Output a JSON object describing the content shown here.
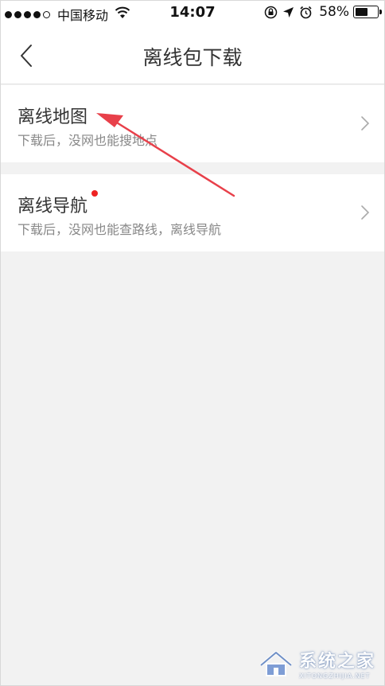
{
  "status_bar": {
    "carrier": "中国移动",
    "time": "14:07",
    "battery_percent": "58%",
    "battery_level": 0.58,
    "icons": [
      "signal-dots-icon",
      "wifi-icon",
      "orientation-lock-icon",
      "location-arrow-icon",
      "alarm-icon",
      "battery-icon"
    ]
  },
  "nav": {
    "title": "离线包下载",
    "back_icon": "chevron-left-icon"
  },
  "list": {
    "items": [
      {
        "title": "离线地图",
        "subtitle": "下载后，没网也能搜地点",
        "has_badge": false
      },
      {
        "title": "离线导航",
        "subtitle": "下载后，没网也能查路线，离线导航",
        "has_badge": true
      }
    ]
  },
  "annotation": {
    "color": "#e8404a"
  },
  "watermark": {
    "text_cn": "系统之家",
    "text_en": "XITONGZHIJIA.NET"
  },
  "colors": {
    "badge": "#ee2222",
    "background": "#f2f2f2"
  }
}
